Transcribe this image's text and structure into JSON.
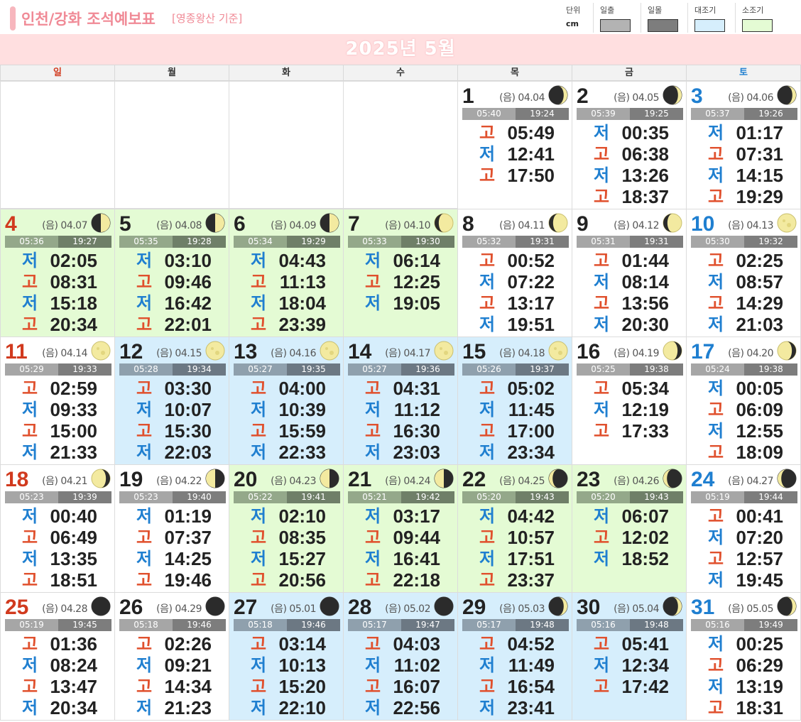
{
  "header": {
    "title": "인천/강화 조석예보표",
    "subtitle": "[영종왕산 기준]",
    "legend": {
      "unit_label": "단위",
      "unit_value": "cm",
      "sunrise_label": "일출",
      "sunset_label": "일몰",
      "spring_tide_label": "대조기",
      "neap_tide_label": "소조기",
      "sunrise_color": "#b3b3b3",
      "sunset_color": "#7d7d7d",
      "spring_tide_color": "#d6eefc",
      "neap_tide_color": "#e4fbd4"
    }
  },
  "month_title": "2025년 5월",
  "weekdays": [
    "일",
    "월",
    "화",
    "수",
    "목",
    "금",
    "토"
  ],
  "tide_labels": {
    "high": "고",
    "low": "저"
  },
  "days": [
    {
      "day": "1",
      "lunar": "(음) 04.04",
      "moon": "waxing-crescent",
      "rise": "05:40",
      "set": "19:24",
      "type": "plain",
      "tides": [
        {
          "k": "high",
          "t": "05:49"
        },
        {
          "k": "low",
          "t": "12:41"
        },
        {
          "k": "high",
          "t": "17:50"
        }
      ]
    },
    {
      "day": "2",
      "lunar": "(음) 04.05",
      "moon": "waxing-crescent",
      "rise": "05:39",
      "set": "19:25",
      "type": "plain",
      "tides": [
        {
          "k": "low",
          "t": "00:35"
        },
        {
          "k": "high",
          "t": "06:38"
        },
        {
          "k": "low",
          "t": "13:26"
        },
        {
          "k": "high",
          "t": "18:37"
        }
      ]
    },
    {
      "day": "3",
      "lunar": "(음) 04.06",
      "moon": "waxing-crescent",
      "rise": "05:37",
      "set": "19:26",
      "type": "plain",
      "tides": [
        {
          "k": "low",
          "t": "01:17"
        },
        {
          "k": "high",
          "t": "07:31"
        },
        {
          "k": "low",
          "t": "14:15"
        },
        {
          "k": "high",
          "t": "19:29"
        }
      ]
    },
    {
      "day": "4",
      "lunar": "(음) 04.07",
      "moon": "first-quarter",
      "rise": "05:36",
      "set": "19:27",
      "type": "green",
      "tides": [
        {
          "k": "low",
          "t": "02:05"
        },
        {
          "k": "high",
          "t": "08:31"
        },
        {
          "k": "low",
          "t": "15:18"
        },
        {
          "k": "high",
          "t": "20:34"
        }
      ]
    },
    {
      "day": "5",
      "lunar": "(음) 04.08",
      "moon": "first-quarter",
      "rise": "05:35",
      "set": "19:28",
      "type": "green",
      "tides": [
        {
          "k": "low",
          "t": "03:10"
        },
        {
          "k": "high",
          "t": "09:46"
        },
        {
          "k": "low",
          "t": "16:42"
        },
        {
          "k": "high",
          "t": "22:01"
        }
      ]
    },
    {
      "day": "6",
      "lunar": "(음) 04.09",
      "moon": "first-quarter",
      "rise": "05:34",
      "set": "19:29",
      "type": "green",
      "tides": [
        {
          "k": "low",
          "t": "04:43"
        },
        {
          "k": "high",
          "t": "11:13"
        },
        {
          "k": "low",
          "t": "18:04"
        },
        {
          "k": "high",
          "t": "23:39"
        }
      ]
    },
    {
      "day": "7",
      "lunar": "(음) 04.10",
      "moon": "waxing-gibbous",
      "rise": "05:33",
      "set": "19:30",
      "type": "green",
      "tides": [
        {
          "k": "low",
          "t": "06:14"
        },
        {
          "k": "high",
          "t": "12:25"
        },
        {
          "k": "low",
          "t": "19:05"
        }
      ]
    },
    {
      "day": "8",
      "lunar": "(음) 04.11",
      "moon": "waxing-gibbous",
      "rise": "05:32",
      "set": "19:31",
      "type": "plain",
      "tides": [
        {
          "k": "high",
          "t": "00:52"
        },
        {
          "k": "low",
          "t": "07:22"
        },
        {
          "k": "high",
          "t": "13:17"
        },
        {
          "k": "low",
          "t": "19:51"
        }
      ]
    },
    {
      "day": "9",
      "lunar": "(음) 04.12",
      "moon": "waxing-gibbous",
      "rise": "05:31",
      "set": "19:31",
      "type": "plain",
      "tides": [
        {
          "k": "high",
          "t": "01:44"
        },
        {
          "k": "low",
          "t": "08:14"
        },
        {
          "k": "high",
          "t": "13:56"
        },
        {
          "k": "low",
          "t": "20:30"
        }
      ]
    },
    {
      "day": "10",
      "lunar": "(음) 04.13",
      "moon": "full",
      "rise": "05:30",
      "set": "19:32",
      "type": "plain",
      "tides": [
        {
          "k": "high",
          "t": "02:25"
        },
        {
          "k": "low",
          "t": "08:57"
        },
        {
          "k": "high",
          "t": "14:29"
        },
        {
          "k": "low",
          "t": "21:03"
        }
      ]
    },
    {
      "day": "11",
      "lunar": "(음) 04.14",
      "moon": "full",
      "rise": "05:29",
      "set": "19:33",
      "type": "plain",
      "tides": [
        {
          "k": "high",
          "t": "02:59"
        },
        {
          "k": "low",
          "t": "09:33"
        },
        {
          "k": "high",
          "t": "15:00"
        },
        {
          "k": "low",
          "t": "21:33"
        }
      ]
    },
    {
      "day": "12",
      "lunar": "(음) 04.15",
      "moon": "full",
      "rise": "05:28",
      "set": "19:34",
      "type": "blue",
      "tides": [
        {
          "k": "high",
          "t": "03:30"
        },
        {
          "k": "low",
          "t": "10:07"
        },
        {
          "k": "high",
          "t": "15:30"
        },
        {
          "k": "low",
          "t": "22:03"
        }
      ]
    },
    {
      "day": "13",
      "lunar": "(음) 04.16",
      "moon": "full",
      "rise": "05:27",
      "set": "19:35",
      "type": "blue",
      "tides": [
        {
          "k": "high",
          "t": "04:00"
        },
        {
          "k": "low",
          "t": "10:39"
        },
        {
          "k": "high",
          "t": "15:59"
        },
        {
          "k": "low",
          "t": "22:33"
        }
      ]
    },
    {
      "day": "14",
      "lunar": "(음) 04.17",
      "moon": "full",
      "rise": "05:27",
      "set": "19:36",
      "type": "blue",
      "tides": [
        {
          "k": "high",
          "t": "04:31"
        },
        {
          "k": "low",
          "t": "11:12"
        },
        {
          "k": "high",
          "t": "16:30"
        },
        {
          "k": "low",
          "t": "23:03"
        }
      ]
    },
    {
      "day": "15",
      "lunar": "(음) 04.18",
      "moon": "full",
      "rise": "05:26",
      "set": "19:37",
      "type": "blue",
      "tides": [
        {
          "k": "high",
          "t": "05:02"
        },
        {
          "k": "low",
          "t": "11:45"
        },
        {
          "k": "high",
          "t": "17:00"
        },
        {
          "k": "low",
          "t": "23:34"
        }
      ]
    },
    {
      "day": "16",
      "lunar": "(음) 04.19",
      "moon": "waning-gibbous",
      "rise": "05:25",
      "set": "19:38",
      "type": "plain",
      "tides": [
        {
          "k": "high",
          "t": "05:34"
        },
        {
          "k": "low",
          "t": "12:19"
        },
        {
          "k": "high",
          "t": "17:33"
        }
      ]
    },
    {
      "day": "17",
      "lunar": "(음) 04.20",
      "moon": "waning-gibbous",
      "rise": "05:24",
      "set": "19:38",
      "type": "plain",
      "tides": [
        {
          "k": "low",
          "t": "00:05"
        },
        {
          "k": "high",
          "t": "06:09"
        },
        {
          "k": "low",
          "t": "12:55"
        },
        {
          "k": "high",
          "t": "18:09"
        }
      ]
    },
    {
      "day": "18",
      "lunar": "(음) 04.21",
      "moon": "waning-gibbous",
      "rise": "05:23",
      "set": "19:39",
      "type": "plain",
      "tides": [
        {
          "k": "low",
          "t": "00:40"
        },
        {
          "k": "high",
          "t": "06:49"
        },
        {
          "k": "low",
          "t": "13:35"
        },
        {
          "k": "high",
          "t": "18:51"
        }
      ]
    },
    {
      "day": "19",
      "lunar": "(음) 04.22",
      "moon": "last-quarter",
      "rise": "05:23",
      "set": "19:40",
      "type": "plain",
      "tides": [
        {
          "k": "low",
          "t": "01:19"
        },
        {
          "k": "high",
          "t": "07:37"
        },
        {
          "k": "low",
          "t": "14:25"
        },
        {
          "k": "high",
          "t": "19:46"
        }
      ]
    },
    {
      "day": "20",
      "lunar": "(음) 04.23",
      "moon": "last-quarter",
      "rise": "05:22",
      "set": "19:41",
      "type": "green",
      "tides": [
        {
          "k": "low",
          "t": "02:10"
        },
        {
          "k": "high",
          "t": "08:35"
        },
        {
          "k": "low",
          "t": "15:27"
        },
        {
          "k": "high",
          "t": "20:56"
        }
      ]
    },
    {
      "day": "21",
      "lunar": "(음) 04.24",
      "moon": "last-quarter",
      "rise": "05:21",
      "set": "19:42",
      "type": "green",
      "tides": [
        {
          "k": "low",
          "t": "03:17"
        },
        {
          "k": "high",
          "t": "09:44"
        },
        {
          "k": "low",
          "t": "16:41"
        },
        {
          "k": "high",
          "t": "22:18"
        }
      ]
    },
    {
      "day": "22",
      "lunar": "(음) 04.25",
      "moon": "waning-crescent",
      "rise": "05:20",
      "set": "19:43",
      "type": "green",
      "tides": [
        {
          "k": "low",
          "t": "04:42"
        },
        {
          "k": "high",
          "t": "10:57"
        },
        {
          "k": "low",
          "t": "17:51"
        },
        {
          "k": "high",
          "t": "23:37"
        }
      ]
    },
    {
      "day": "23",
      "lunar": "(음) 04.26",
      "moon": "waning-crescent",
      "rise": "05:20",
      "set": "19:43",
      "type": "green",
      "tides": [
        {
          "k": "low",
          "t": "06:07"
        },
        {
          "k": "high",
          "t": "12:02"
        },
        {
          "k": "low",
          "t": "18:52"
        }
      ]
    },
    {
      "day": "24",
      "lunar": "(음) 04.27",
      "moon": "waning-crescent",
      "rise": "05:19",
      "set": "19:44",
      "type": "plain",
      "tides": [
        {
          "k": "high",
          "t": "00:41"
        },
        {
          "k": "low",
          "t": "07:20"
        },
        {
          "k": "high",
          "t": "12:57"
        },
        {
          "k": "low",
          "t": "19:45"
        }
      ]
    },
    {
      "day": "25",
      "lunar": "(음) 04.28",
      "moon": "new",
      "rise": "05:19",
      "set": "19:45",
      "type": "plain",
      "tides": [
        {
          "k": "high",
          "t": "01:36"
        },
        {
          "k": "low",
          "t": "08:24"
        },
        {
          "k": "high",
          "t": "13:47"
        },
        {
          "k": "low",
          "t": "20:34"
        }
      ]
    },
    {
      "day": "26",
      "lunar": "(음) 04.29",
      "moon": "new",
      "rise": "05:18",
      "set": "19:46",
      "type": "plain",
      "tides": [
        {
          "k": "high",
          "t": "02:26"
        },
        {
          "k": "low",
          "t": "09:21"
        },
        {
          "k": "high",
          "t": "14:34"
        },
        {
          "k": "low",
          "t": "21:23"
        }
      ]
    },
    {
      "day": "27",
      "lunar": "(음) 05.01",
      "moon": "new",
      "rise": "05:18",
      "set": "19:46",
      "type": "blue",
      "tides": [
        {
          "k": "high",
          "t": "03:14"
        },
        {
          "k": "low",
          "t": "10:13"
        },
        {
          "k": "high",
          "t": "15:20"
        },
        {
          "k": "low",
          "t": "22:10"
        }
      ]
    },
    {
      "day": "28",
      "lunar": "(음) 05.02",
      "moon": "new",
      "rise": "05:17",
      "set": "19:47",
      "type": "blue",
      "tides": [
        {
          "k": "high",
          "t": "04:03"
        },
        {
          "k": "low",
          "t": "11:02"
        },
        {
          "k": "high",
          "t": "16:07"
        },
        {
          "k": "low",
          "t": "22:56"
        }
      ]
    },
    {
      "day": "29",
      "lunar": "(음) 05.03",
      "moon": "waxing-crescent",
      "rise": "05:17",
      "set": "19:48",
      "type": "blue",
      "tides": [
        {
          "k": "high",
          "t": "04:52"
        },
        {
          "k": "low",
          "t": "11:49"
        },
        {
          "k": "high",
          "t": "16:54"
        },
        {
          "k": "low",
          "t": "23:41"
        }
      ]
    },
    {
      "day": "30",
      "lunar": "(음) 05.04",
      "moon": "waxing-crescent",
      "rise": "05:16",
      "set": "19:48",
      "type": "blue",
      "tides": [
        {
          "k": "high",
          "t": "05:41"
        },
        {
          "k": "low",
          "t": "12:34"
        },
        {
          "k": "high",
          "t": "17:42"
        }
      ]
    },
    {
      "day": "31",
      "lunar": "(음) 05.05",
      "moon": "waxing-crescent",
      "rise": "05:16",
      "set": "19:49",
      "type": "plain",
      "tides": [
        {
          "k": "low",
          "t": "00:25"
        },
        {
          "k": "high",
          "t": "06:29"
        },
        {
          "k": "low",
          "t": "13:19"
        },
        {
          "k": "high",
          "t": "18:31"
        }
      ]
    }
  ]
}
